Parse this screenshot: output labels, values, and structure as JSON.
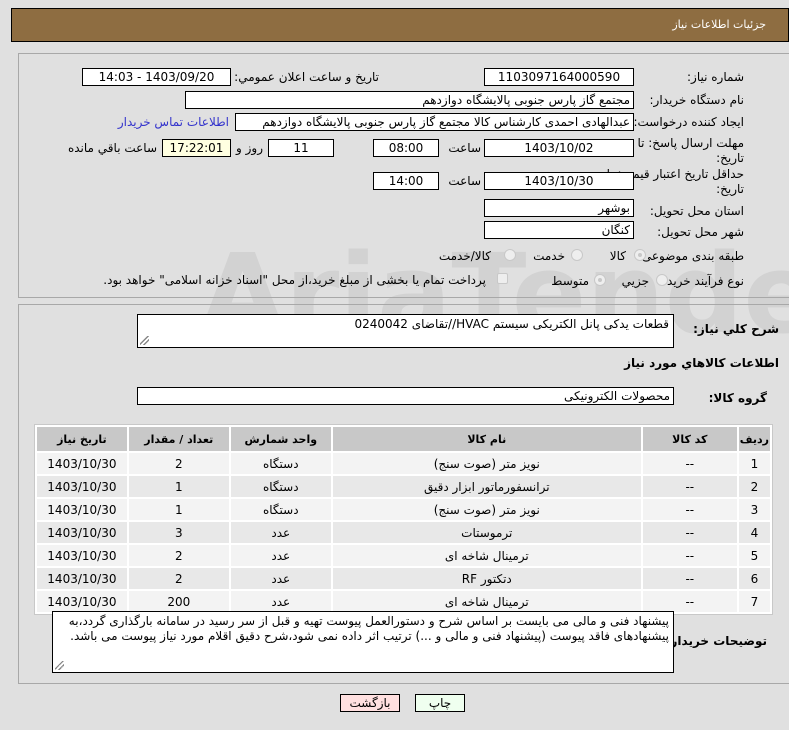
{
  "header": {
    "title": "جزئیات اطلاعات نیاز"
  },
  "form": {
    "need_number_label": "شماره نیاز:",
    "need_number": "1103097164000590",
    "announce_label": "تاریخ و ساعت اعلان عمومي:",
    "announce_value": "1403/09/20 - 14:03",
    "buyer_org_label": "نام دستگاه خریدار:",
    "buyer_org": "مجتمع گاز پارس جنوبی  پالایشگاه دوازدهم",
    "creator_label": "ایجاد کننده درخواست:",
    "creator": "عبدالهادی احمدی کارشناس کالا مجتمع گاز پارس جنوبی  پالایشگاه دوازدهم",
    "contact_link": "اطلاعات تماس خریدار",
    "deadline_label": "مهلت ارسال پاسخ: تا تاریخ:",
    "deadline_date": "1403/10/02",
    "time_label": "ساعت",
    "deadline_time": "08:00",
    "days_value": "11",
    "days_label": "روز و",
    "remaining_time": "17:22:01",
    "remaining_label": "ساعت باقي مانده",
    "validity_label": "حداقل تاریخ اعتبار قیمت: تا تاریخ:",
    "validity_date": "1403/10/30",
    "validity_time": "14:00",
    "province_label": "استان محل تحویل:",
    "province": "بوشهر",
    "city_label": "شهر محل تحویل:",
    "city": "کنگان",
    "category_label": "طبقه بندی موضوعی:",
    "category_options": [
      "کالا",
      "خدمت",
      "کالا/خدمت"
    ],
    "category_selected": "کالا",
    "process_label": "نوع فرآیند خرید :",
    "process_options": [
      "جزیي",
      "متوسط"
    ],
    "process_selected": "متوسط",
    "treasury_note": "پرداخت تمام یا بخشی از مبلغ خرید،از محل \"اسناد خزانه اسلامی\" خواهد بود."
  },
  "details": {
    "description_label": "شرح کلي نیاز:",
    "description": "قطعات یدکی پانل الکتریکی سیستم HVAC//تقاضای 0240042",
    "items_heading": "اطلاعات کالاهاي مورد نیاز",
    "group_label": "گروه کالا:",
    "group_value": "محصولات الکترونیکی"
  },
  "table": {
    "headers": [
      "ردیف",
      "کد کالا",
      "نام کالا",
      "واحد شمارش",
      "تعداد / مقدار",
      "تاریخ نیاز"
    ],
    "rows": [
      [
        "1",
        "--",
        "نویز متر (صوت سنج)",
        "دستگاه",
        "2",
        "1403/10/30"
      ],
      [
        "2",
        "--",
        "ترانسفورماتور ابزار دقیق",
        "دستگاه",
        "1",
        "1403/10/30"
      ],
      [
        "3",
        "--",
        "نویز متر (صوت سنج)",
        "دستگاه",
        "1",
        "1403/10/30"
      ],
      [
        "4",
        "--",
        "ترموستات",
        "عدد",
        "3",
        "1403/10/30"
      ],
      [
        "5",
        "--",
        "ترمینال شاخه ای",
        "عدد",
        "2",
        "1403/10/30"
      ],
      [
        "6",
        "--",
        "دتکتور RF",
        "عدد",
        "2",
        "1403/10/30"
      ],
      [
        "7",
        "--",
        "ترمینال شاخه ای",
        "عدد",
        "200",
        "1403/10/30"
      ]
    ]
  },
  "notes": {
    "label": "توضیحات خریدار:",
    "text": "پیشنهاد فنی و مالی می بایست بر اساس شرح و دستورالعمل پیوست تهیه و قبل از سر رسید در سامانه بارگذاری گردد،به پیشنهادهای فاقد پیوست (پیشنهاد فنی و مالی و ...) ترتیب اثر داده نمی شود،شرح دقیق اقلام مورد نیاز پیوست می باشد."
  },
  "buttons": {
    "print": "چاپ",
    "back": "بازگشت"
  },
  "watermark": "AriaTender.net"
}
